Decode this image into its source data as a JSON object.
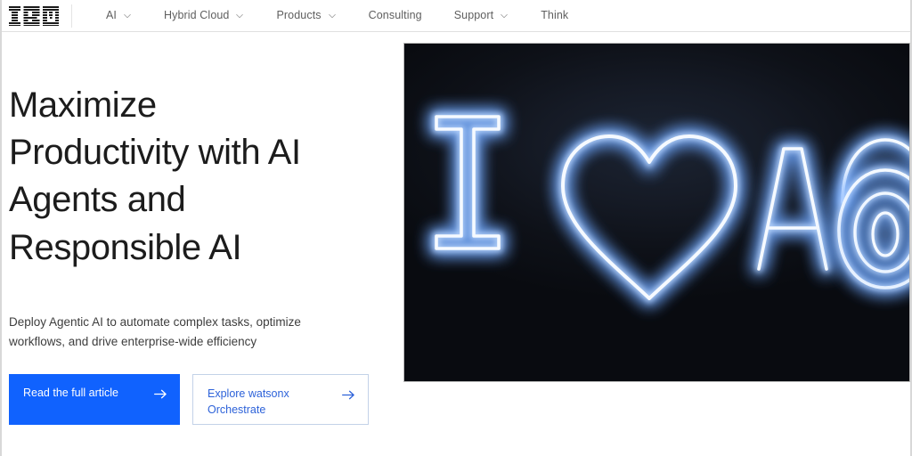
{
  "masthead": {
    "logo_alt": "IBM",
    "nav_items": [
      {
        "label": "AI",
        "has_chevron": true
      },
      {
        "label": "Hybrid Cloud",
        "has_chevron": true
      },
      {
        "label": "Products",
        "has_chevron": true
      },
      {
        "label": "Consulting",
        "has_chevron": false
      },
      {
        "label": "Support",
        "has_chevron": true
      },
      {
        "label": "Think",
        "has_chevron": false
      }
    ]
  },
  "hero": {
    "headline_lines": [
      "Maximize",
      "Productivity with AI",
      "Agents and",
      "Responsible AI"
    ],
    "subhead_lines": [
      "Deploy Agentic AI to automate complex tasks, optimize",
      "workflows, and drive enterprise-wide efficiency"
    ],
    "primary_cta": {
      "label": "Read the full article",
      "icon": "arrow-right-icon"
    },
    "secondary_cta": {
      "label": "Explore watsonx Orchestrate",
      "icon": "arrow-right-icon"
    },
    "image": {
      "description": "Neon sign reading I heart A fingerprint",
      "glyphs": [
        "letter-I",
        "heart",
        "letter-A",
        "fingerprint"
      ],
      "background_color": "#101520",
      "neon_color": "#f2f7ff",
      "glow_color": "#7fb4ff"
    }
  },
  "colors": {
    "brand_blue": "#1062fe",
    "secondary_border": "#c3d2e8",
    "secondary_text": "#2d62d9",
    "nav_text": "#5f5f5f",
    "headline_text": "#1c1c1c",
    "subhead_text": "#3d3d3d",
    "divider": "#e0e0e0",
    "page_background": "#ffffff"
  }
}
